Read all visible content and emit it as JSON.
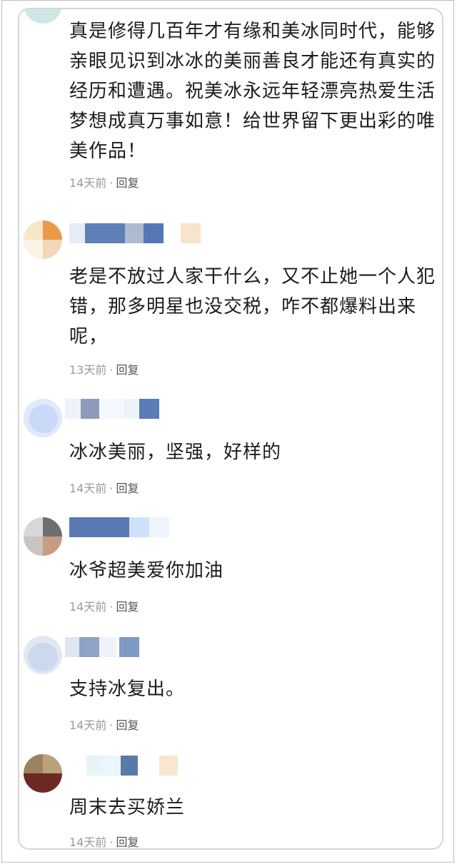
{
  "comments": [
    {
      "text": "真是修得几百年才有缘和美冰同时代，能够亲眼见识到冰冰的美丽善良才能还有真实的经历和遭遇。祝美冰永远年轻漂亮热爱生活梦想成真万事如意！给世界留下更出彩的唯美作品！",
      "time": "14天前",
      "separator": "·",
      "reply": "回复"
    },
    {
      "text": "老是不放过人家干什么，又不止她一个人犯错，那多明星也没交税，咋不都爆料出来呢，",
      "time": "13天前",
      "separator": "·",
      "reply": "回复"
    },
    {
      "text": "冰冰美丽，坚强，好样的",
      "time": "14天前",
      "separator": "·",
      "reply": "回复"
    },
    {
      "text": "冰爷超美爱你加油",
      "time": "14天前",
      "separator": "·",
      "reply": "回复"
    },
    {
      "text": "支持冰复出。",
      "time": "14天前",
      "separator": "·",
      "reply": "回复"
    },
    {
      "text": "周末去买娇兰",
      "time": "14天前",
      "separator": "·",
      "reply": "回复"
    }
  ],
  "colors": {
    "text": "#1c1c1c",
    "meta": "#9a9a9a",
    "reply": "#555555",
    "card_border": "#d6d6d6"
  }
}
